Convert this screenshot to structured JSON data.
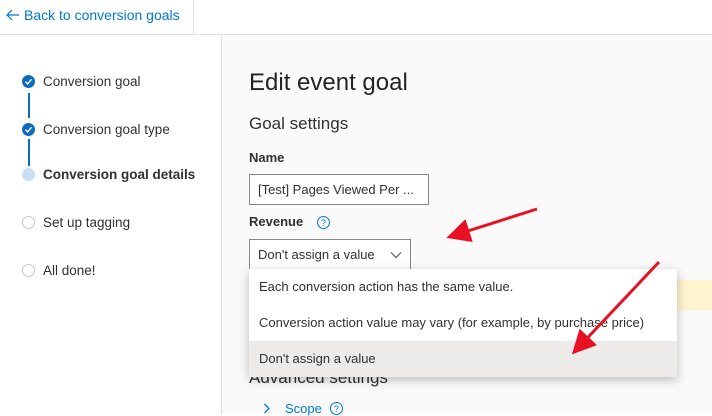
{
  "topbar": {
    "back_label": "Back to conversion goals"
  },
  "stepper": {
    "steps": [
      {
        "label": "Conversion goal",
        "state": "done"
      },
      {
        "label": "Conversion goal type",
        "state": "done"
      },
      {
        "label": "Conversion goal details",
        "state": "current"
      },
      {
        "label": "Set up tagging",
        "state": "todo"
      },
      {
        "label": "All done!",
        "state": "todo"
      }
    ]
  },
  "main": {
    "title": "Edit event goal",
    "subtitle": "Goal settings",
    "name_label": "Name",
    "name_value": "[Test] Pages Viewed Per ...",
    "revenue_label": "Revenue",
    "revenue_help": "?",
    "revenue_selected": "Don't assign a value",
    "advanced_label": "Advanced settings",
    "scope_label": "Scope",
    "scope_help": "?"
  },
  "dropdown": {
    "options": [
      "Each conversion action has the same value.",
      "Conversion action value may vary (for example, by purchase price)",
      "Don't assign a value"
    ],
    "selected_index": 2
  },
  "colors": {
    "accent": "#0078d4",
    "annotation": "#e81123"
  }
}
